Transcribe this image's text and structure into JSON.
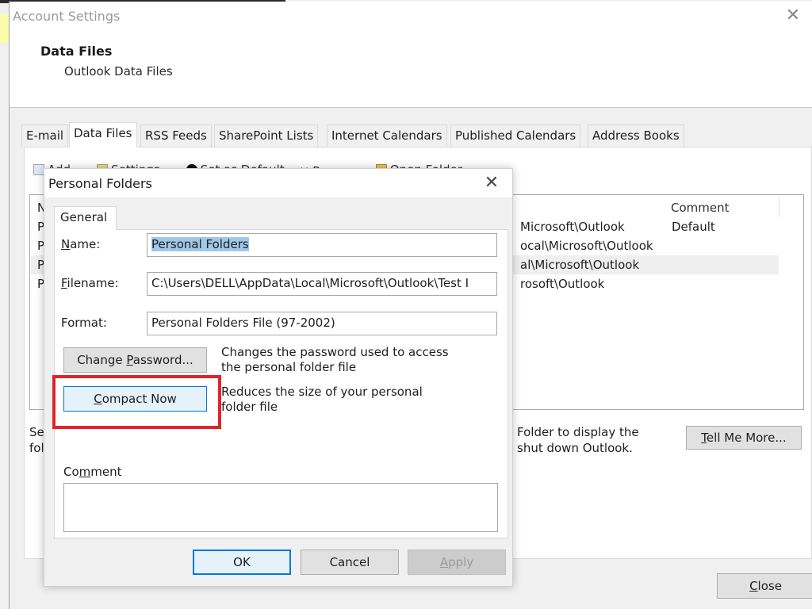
{
  "account_settings": {
    "window_title": "Account Settings",
    "header_title": "Data Files",
    "header_subtitle": "Outlook Data Files",
    "tabs": [
      {
        "label": "E-mail",
        "active": false
      },
      {
        "label": "Data Files",
        "active": true
      },
      {
        "label": "RSS Feeds",
        "active": false
      },
      {
        "label": "SharePoint Lists",
        "active": false
      },
      {
        "label": "Internet Calendars",
        "active": false
      },
      {
        "label": "Published Calendars",
        "active": false
      },
      {
        "label": "Address Books",
        "active": false
      }
    ],
    "toolbar": [
      {
        "label": "Add...",
        "icon": "add-file-icon"
      },
      {
        "label": "Settings...",
        "icon": "settings-icon"
      },
      {
        "label": "Set as Default",
        "icon": "default-check-icon"
      },
      {
        "label": "Remove",
        "icon": "remove-x-icon"
      },
      {
        "label": "Open Folder...",
        "icon": "folder-icon"
      }
    ],
    "file_list": {
      "columns": {
        "name_partial": "N",
        "comment": "Comment"
      },
      "rows": [
        {
          "name_partial": "P",
          "location_partial": "Microsoft\\Outlook",
          "comment": "Default",
          "selected": false
        },
        {
          "name_partial": "P",
          "location_partial": "ocal\\Microsoft\\Outlook",
          "comment": "",
          "selected": false
        },
        {
          "name_partial": "P",
          "location_partial": "al\\Microsoft\\Outlook",
          "comment": "",
          "selected": true
        },
        {
          "name_partial": "P",
          "location_partial": "rosoft\\Outlook",
          "comment": "",
          "selected": false
        }
      ]
    },
    "info_left_line1": "Se",
    "info_left_line2": "fol",
    "info_right_line1": "Folder to display the",
    "info_right_line2": "shut down Outlook.",
    "tell_me_more": {
      "pre": "",
      "accel": "T",
      "post": "ell Me More..."
    },
    "close": {
      "pre": "",
      "accel": "C",
      "post": "lose"
    }
  },
  "personal_folders": {
    "title": "Personal Folders",
    "tab_general": "General",
    "name_label": {
      "pre": "",
      "accel": "N",
      "post": "ame:"
    },
    "name_value": "Personal Folders",
    "filename_label": {
      "pre": "",
      "accel": "F",
      "post": "ilename:"
    },
    "filename_value": "C:\\Users\\DELL\\AppData\\Local\\Microsoft\\Outlook\\Test I",
    "format_label": "Format:",
    "format_value": "Personal Folders File (97-2002)",
    "change_password": {
      "pre": "Change ",
      "accel": "P",
      "post": "assword..."
    },
    "change_password_desc_line1": "Changes the password used to access",
    "change_password_desc_line2": "the personal folder file",
    "compact_now": {
      "pre": "",
      "accel": "C",
      "post": "ompact Now"
    },
    "compact_desc_line1": "Reduces the size of your personal",
    "compact_desc_line2": "folder file",
    "comment_label": {
      "pre": "Co",
      "accel": "m",
      "post": "ment"
    },
    "comment_value": "",
    "ok": "OK",
    "cancel": "Cancel",
    "apply": {
      "pre": "",
      "accel": "A",
      "post": "pply"
    },
    "highlight_color": "#e0242b"
  }
}
